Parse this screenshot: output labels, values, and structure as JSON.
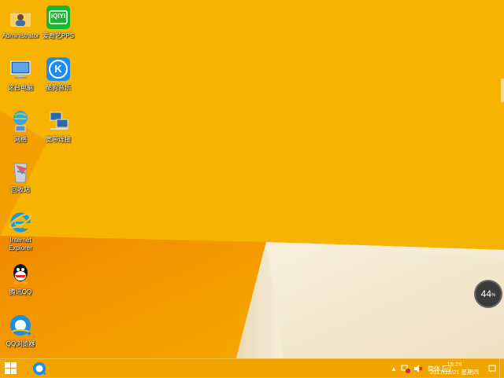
{
  "desktop": {
    "icons": [
      {
        "label": "Administrator",
        "icon": "user-folder-icon"
      },
      {
        "label": "爱奇艺PPS",
        "icon": "iqiyi-icon"
      },
      {
        "label": "这台电脑",
        "icon": "computer-icon"
      },
      {
        "label": "酷狗音乐",
        "icon": "kugou-icon"
      },
      {
        "label": "网络",
        "icon": "network-icon"
      },
      {
        "label": "宽带连接",
        "icon": "broadband-icon"
      },
      {
        "label": "回收站",
        "icon": "recycle-bin-icon"
      },
      {
        "label": "Internet Explorer",
        "icon": "internet-explorer-icon"
      },
      {
        "label": "腾讯QQ",
        "icon": "qq-icon"
      },
      {
        "label": "QQ浏览器",
        "icon": "qq-browser-icon"
      }
    ],
    "iqiyi_logo_text": "iQIYI",
    "kugou_logo_text": "K"
  },
  "speed_widget": {
    "value": "44",
    "unit": "%"
  },
  "taskbar": {
    "tray": {
      "input_method": "简体",
      "time": "15:29",
      "date": "2017/12/21 星期四"
    }
  },
  "colors": {
    "wallpaper": "#F5B000",
    "wallpaper_dark": "#E68A00",
    "taskbar": "#F0A500",
    "cream": "#F4EAD6"
  }
}
